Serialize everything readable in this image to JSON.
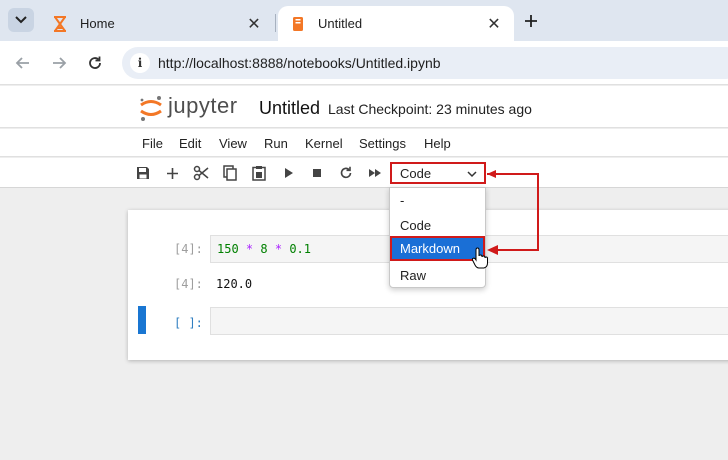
{
  "browser": {
    "tabs": [
      {
        "title": "Home",
        "icon": "hourglass-icon",
        "close": "✕"
      },
      {
        "title": "Untitled",
        "icon": "notebook-icon",
        "close": "✕"
      }
    ],
    "new_tab": "+",
    "url": "http://localhost:8888/notebooks/Untitled.ipynb"
  },
  "header": {
    "wordmark": "jupyter",
    "notebook_name": "Untitled",
    "checkpoint": "Last Checkpoint: 23 minutes ago"
  },
  "menu": {
    "items": [
      "File",
      "Edit",
      "View",
      "Run",
      "Kernel",
      "Settings",
      "Help"
    ]
  },
  "toolbar": {
    "cell_type": "Code",
    "icons": [
      "save-icon",
      "add-icon",
      "cut-icon",
      "copy-icon",
      "paste-icon",
      "run-icon",
      "stop-icon",
      "restart-icon",
      "fast-forward-icon"
    ]
  },
  "dropdown": {
    "options": [
      "-",
      "Code",
      "Markdown",
      "Raw"
    ],
    "highlighted": "Markdown"
  },
  "cells": [
    {
      "in_prompt": "[4]:",
      "code_tokens": [
        {
          "t": "150",
          "k": "num"
        },
        {
          "t": " ",
          "k": "ws"
        },
        {
          "t": "*",
          "k": "op"
        },
        {
          "t": " ",
          "k": "ws"
        },
        {
          "t": "8",
          "k": "num"
        },
        {
          "t": " ",
          "k": "ws"
        },
        {
          "t": "*",
          "k": "op"
        },
        {
          "t": " ",
          "k": "ws"
        },
        {
          "t": "0.1",
          "k": "num"
        }
      ],
      "out_prompt": "[4]:",
      "output": "120.0"
    },
    {
      "in_prompt": "[ ]:",
      "code_tokens": []
    }
  ],
  "colors": {
    "accent": "#1976d2",
    "highlight": "#d01a1a",
    "selected_option": "#1a6fd6",
    "jupyter_orange": "#f37726"
  }
}
